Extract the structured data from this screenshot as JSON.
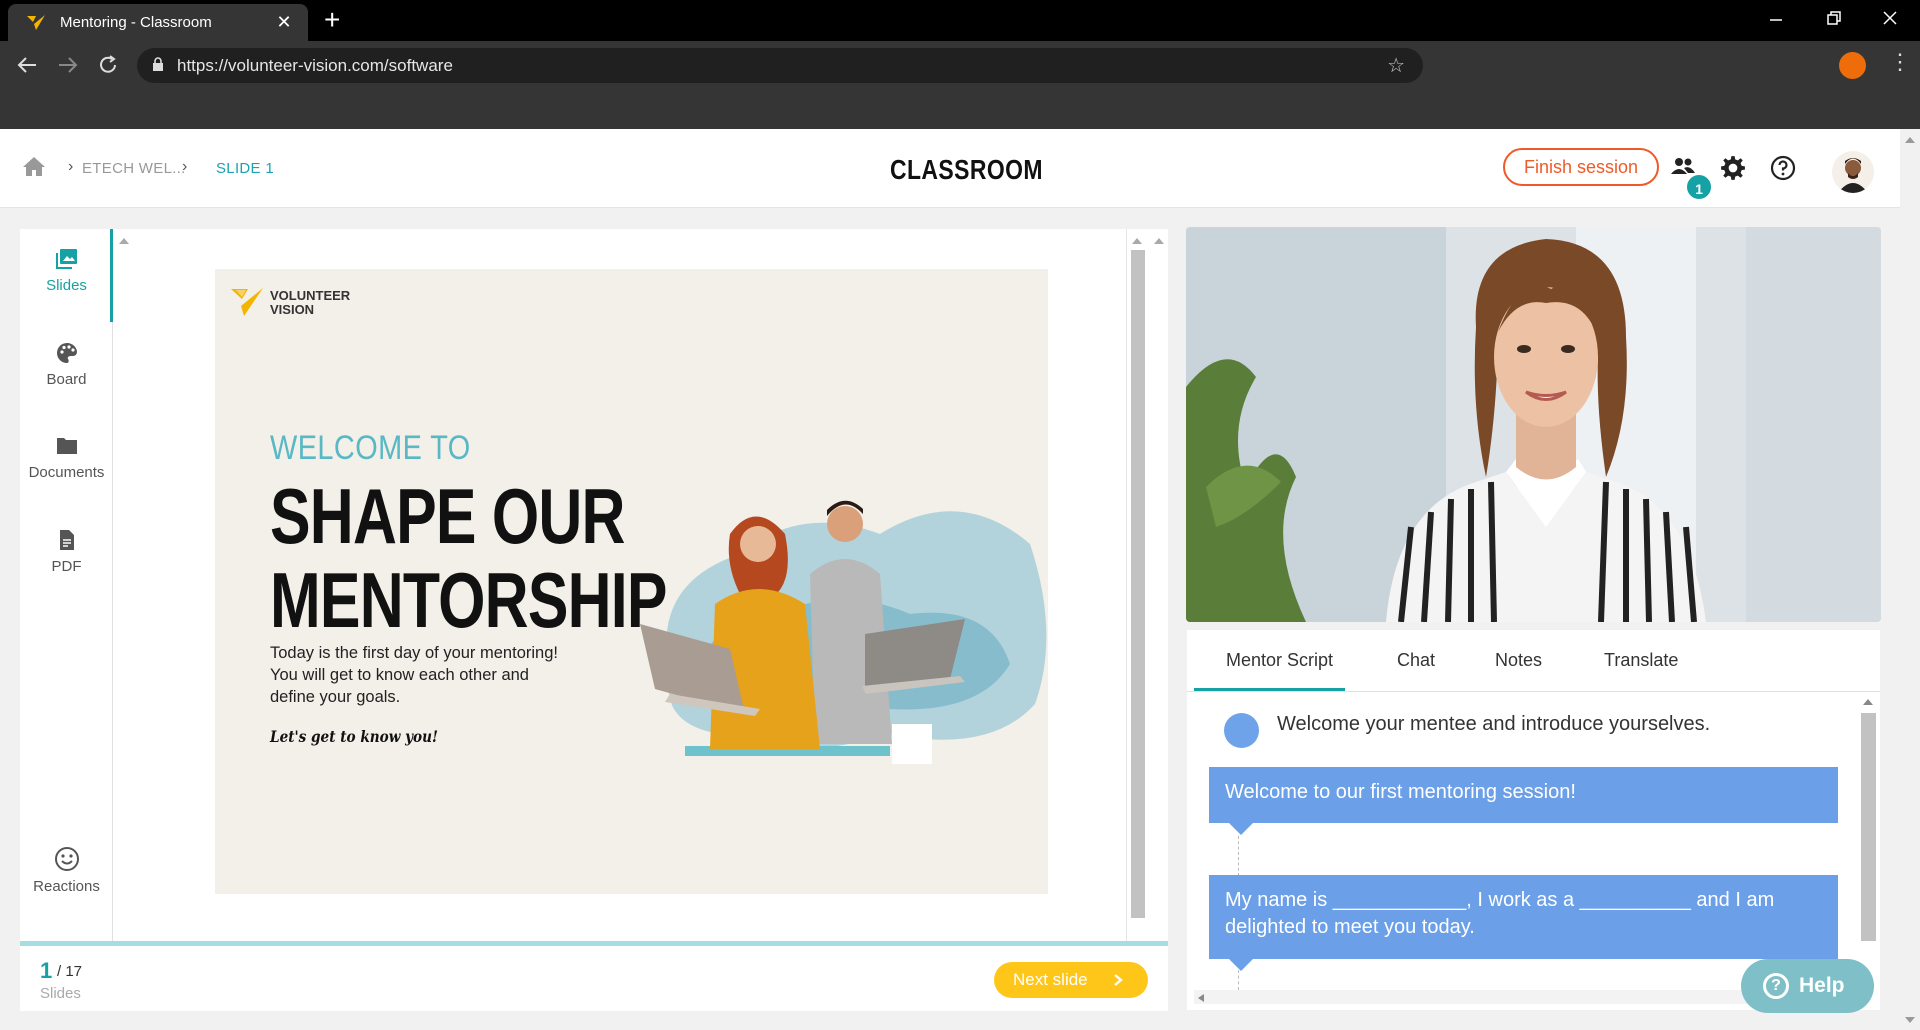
{
  "browser": {
    "tab_title": "Mentoring - Classroom",
    "tab_close": "✕",
    "new_tab": "+",
    "url": "https://volunteer-vision.com/software"
  },
  "header": {
    "breadcrumb": [
      {
        "label": "ETECH WEL..."
      },
      {
        "label": "SLIDE 1"
      }
    ],
    "title": "CLASSROOM",
    "finish_label": "Finish session",
    "participants_count": "1"
  },
  "sidebar": {
    "items": [
      {
        "label": "Slides"
      },
      {
        "label": "Board"
      },
      {
        "label": "Documents"
      },
      {
        "label": "PDF"
      },
      {
        "label": "Reactions"
      }
    ]
  },
  "slide": {
    "logo_line1": "VOLUNTEER",
    "logo_line2": "VISION",
    "welcome": "WELCOME TO",
    "headline_line1": "SHAPE OUR",
    "headline_line2": "MENTORSHIP",
    "body_line1": "Today is the first day of your mentoring!",
    "body_line2": "You will get to know each other and",
    "body_line3": "define your goals.",
    "tagline": "Let's get to know you!"
  },
  "pager": {
    "current": "1",
    "total": "/ 17",
    "caption": "Slides",
    "next_label": "Next slide",
    "progress": 0.06
  },
  "panel": {
    "tabs": [
      {
        "label": "Mentor Script"
      },
      {
        "label": "Chat"
      },
      {
        "label": "Notes"
      },
      {
        "label": "Translate"
      }
    ],
    "instruction": "Welcome your mentee and introduce yourselves.",
    "bubble1": "Welcome to our first mentoring session!",
    "bubble2": "My name is ____________, I work as a __________ and I am delighted to meet you today."
  },
  "help_label": "Help",
  "colors": {
    "accent": "#16a2a5",
    "finish": "#f05a28",
    "next": "#ffc61a",
    "bubble": "#6b9fe8"
  }
}
